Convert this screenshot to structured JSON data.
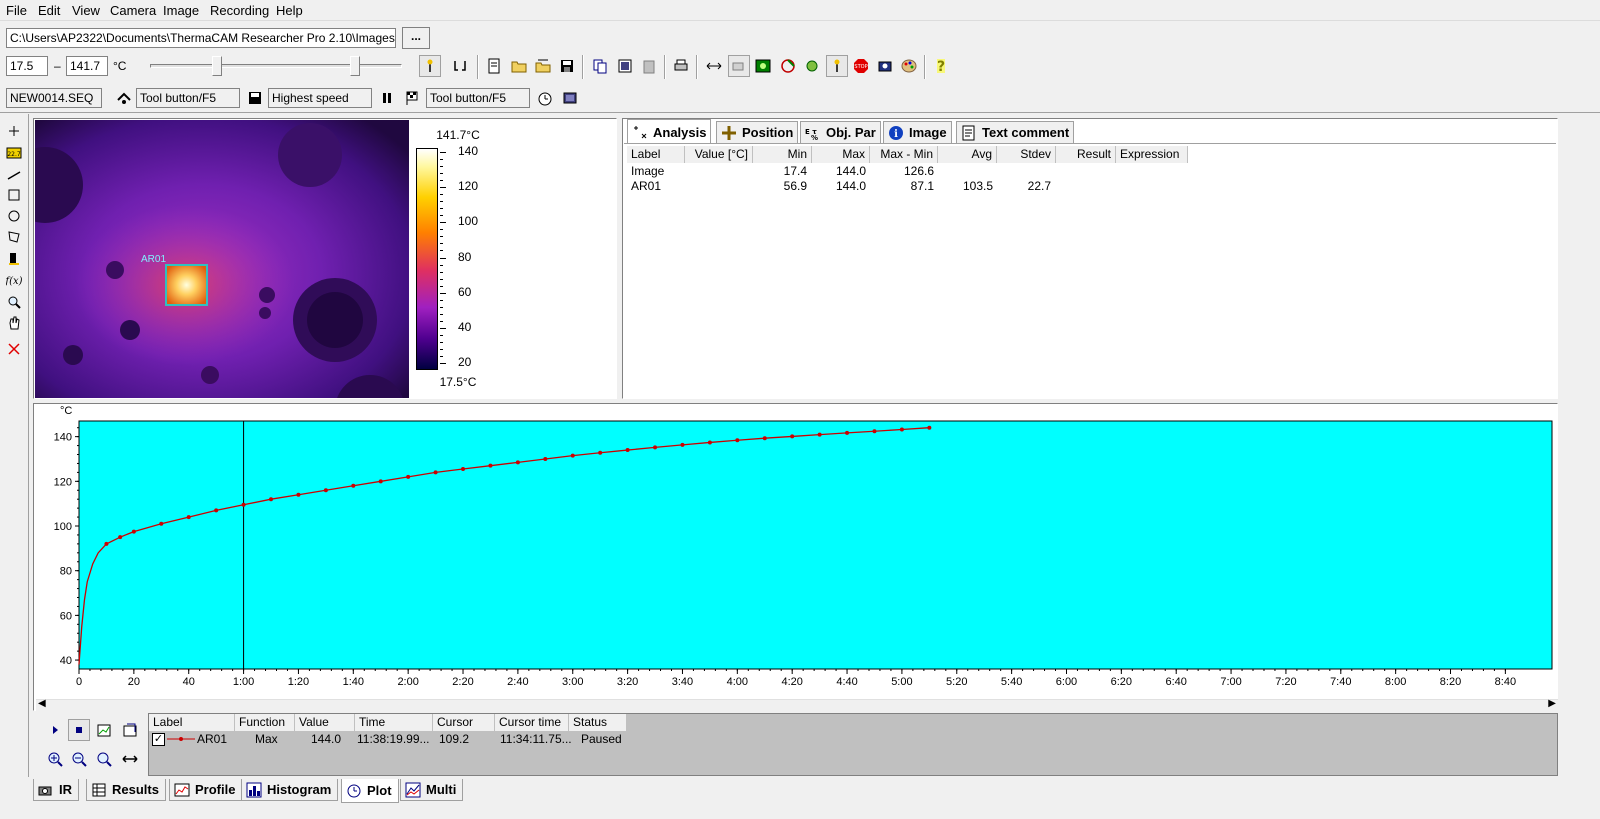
{
  "menu": [
    "File",
    "Edit",
    "View",
    "Camera",
    "Image",
    "Recording",
    "Help"
  ],
  "path": {
    "value": "C:\\Users\\AP2322\\Documents\\ThermaCAM Researcher Pro 2.10\\Images",
    "browse_label": "..."
  },
  "range": {
    "min": "17.5",
    "dash": "–",
    "max": "141.7",
    "unit": "°C"
  },
  "recording": {
    "file": "NEW0014.SEQ",
    "tool1": "Tool button/F5",
    "speed": "Highest speed",
    "tool2": "Tool button/F5"
  },
  "ir_image": {
    "roi_label": "AR01",
    "scale_top": "141.7°C",
    "scale_bottom": "17.5°C",
    "scale_ticks": [
      "140",
      "120",
      "100",
      "80",
      "60",
      "40",
      "20"
    ]
  },
  "analysis": {
    "tabs": [
      "Analysis",
      "Position",
      "Obj. Par",
      "Image",
      "Text comment"
    ],
    "columns": [
      "Label",
      "Value [°C]",
      "Min",
      "Max",
      "Max - Min",
      "Avg",
      "Stdev",
      "Result",
      "Expression"
    ],
    "rows": [
      {
        "label": "Image",
        "value": "",
        "min": "17.4",
        "max": "144.0",
        "maxmin": "126.6",
        "avg": "",
        "stdev": "",
        "result": "",
        "expression": ""
      },
      {
        "label": "AR01",
        "value": "",
        "min": "56.9",
        "max": "144.0",
        "maxmin": "87.1",
        "avg": "103.5",
        "stdev": "22.7",
        "result": "",
        "expression": ""
      }
    ]
  },
  "plot": {
    "unit_label": "°C",
    "background": "#00ffff",
    "line_color": "#cc0000",
    "cursor_x_label": "1:00",
    "x_ticks": [
      "0",
      "20",
      "40",
      "1:00",
      "1:20",
      "1:40",
      "2:00",
      "2:20",
      "2:40",
      "3:00",
      "3:20",
      "3:40",
      "4:00",
      "4:20",
      "4:40",
      "5:00",
      "5:20",
      "5:40",
      "6:00",
      "6:20",
      "6:40",
      "7:00",
      "7:20",
      "7:40",
      "8:00",
      "8:20",
      "8:40"
    ],
    "y_ticks": [
      "140",
      "120",
      "100",
      "80",
      "60",
      "40"
    ]
  },
  "chart_data": {
    "type": "line",
    "xlabel": "",
    "ylabel": "°C",
    "ylim": [
      36,
      147
    ],
    "xlim_seconds": [
      0,
      537
    ],
    "grid": false,
    "series": [
      {
        "name": "AR01",
        "x": [
          0,
          1,
          2,
          3,
          5,
          7,
          10,
          15,
          20,
          30,
          40,
          50,
          60,
          70,
          80,
          90,
          100,
          110,
          120,
          130,
          140,
          150,
          160,
          170,
          180,
          190,
          200,
          210,
          220,
          230,
          240,
          250,
          260,
          270,
          280,
          290,
          300,
          310
        ],
        "y": [
          38,
          55,
          67,
          75,
          83,
          88,
          92,
          95,
          97.5,
          101,
          104,
          107,
          109.5,
          112,
          114,
          116,
          118,
          120,
          122,
          124,
          125.5,
          127,
          128.5,
          130,
          131.5,
          132.8,
          134,
          135.2,
          136.3,
          137.4,
          138.4,
          139.3,
          140.1,
          140.9,
          141.7,
          142.4,
          143.2,
          144
        ]
      }
    ]
  },
  "plot_table": {
    "columns": [
      "Label",
      "Function",
      "Value",
      "Time",
      "Cursor",
      "Cursor time",
      "Status"
    ],
    "row": {
      "label": "AR01",
      "function": "Max",
      "value": "144.0",
      "time": "11:38:19.99...",
      "cursor": "109.2",
      "cursor_time": "11:34:11.75...",
      "status": "Paused"
    }
  },
  "bottom_tabs": [
    "IR",
    "Results",
    "Profile",
    "Histogram",
    "Plot",
    "Multi"
  ]
}
